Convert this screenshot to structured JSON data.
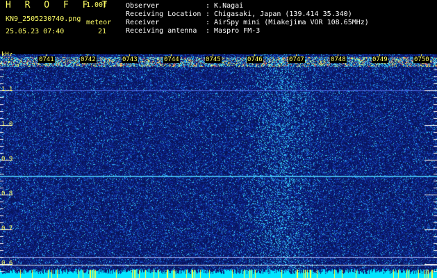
{
  "header": {
    "app_title": "H R O F F T",
    "version": "1.00f",
    "file_name": "KN9_2505230740.png",
    "meteor_label": "meteor",
    "date_time": "25.05.23 07:40",
    "meteor_count": "21"
  },
  "info": [
    {
      "label": "Observer",
      "value": ": K.Nagai"
    },
    {
      "label": "Receiving Location",
      "value": ": Chigasaki, Japan (139.414 35.340)"
    },
    {
      "label": "Receiver",
      "value": ": AirSpy mini (Miakejima VOR 108.65MHz)"
    },
    {
      "label": "Receiving antenna",
      "value": ": Maspro FM-3"
    }
  ],
  "y_axis": {
    "unit": "kHz",
    "ticks": [
      "1.1",
      "1.0",
      "0.9",
      "0.8",
      "0.7",
      "0.6"
    ]
  },
  "time_labels": [
    "0741",
    "0742",
    "0743",
    "0744",
    "0745",
    "0746",
    "0747",
    "0748",
    "0749",
    "0750"
  ],
  "colors": {
    "background": "#000000",
    "plot": "#0a1a66",
    "label": "#ffff66",
    "noise": "#00e5ff"
  }
}
